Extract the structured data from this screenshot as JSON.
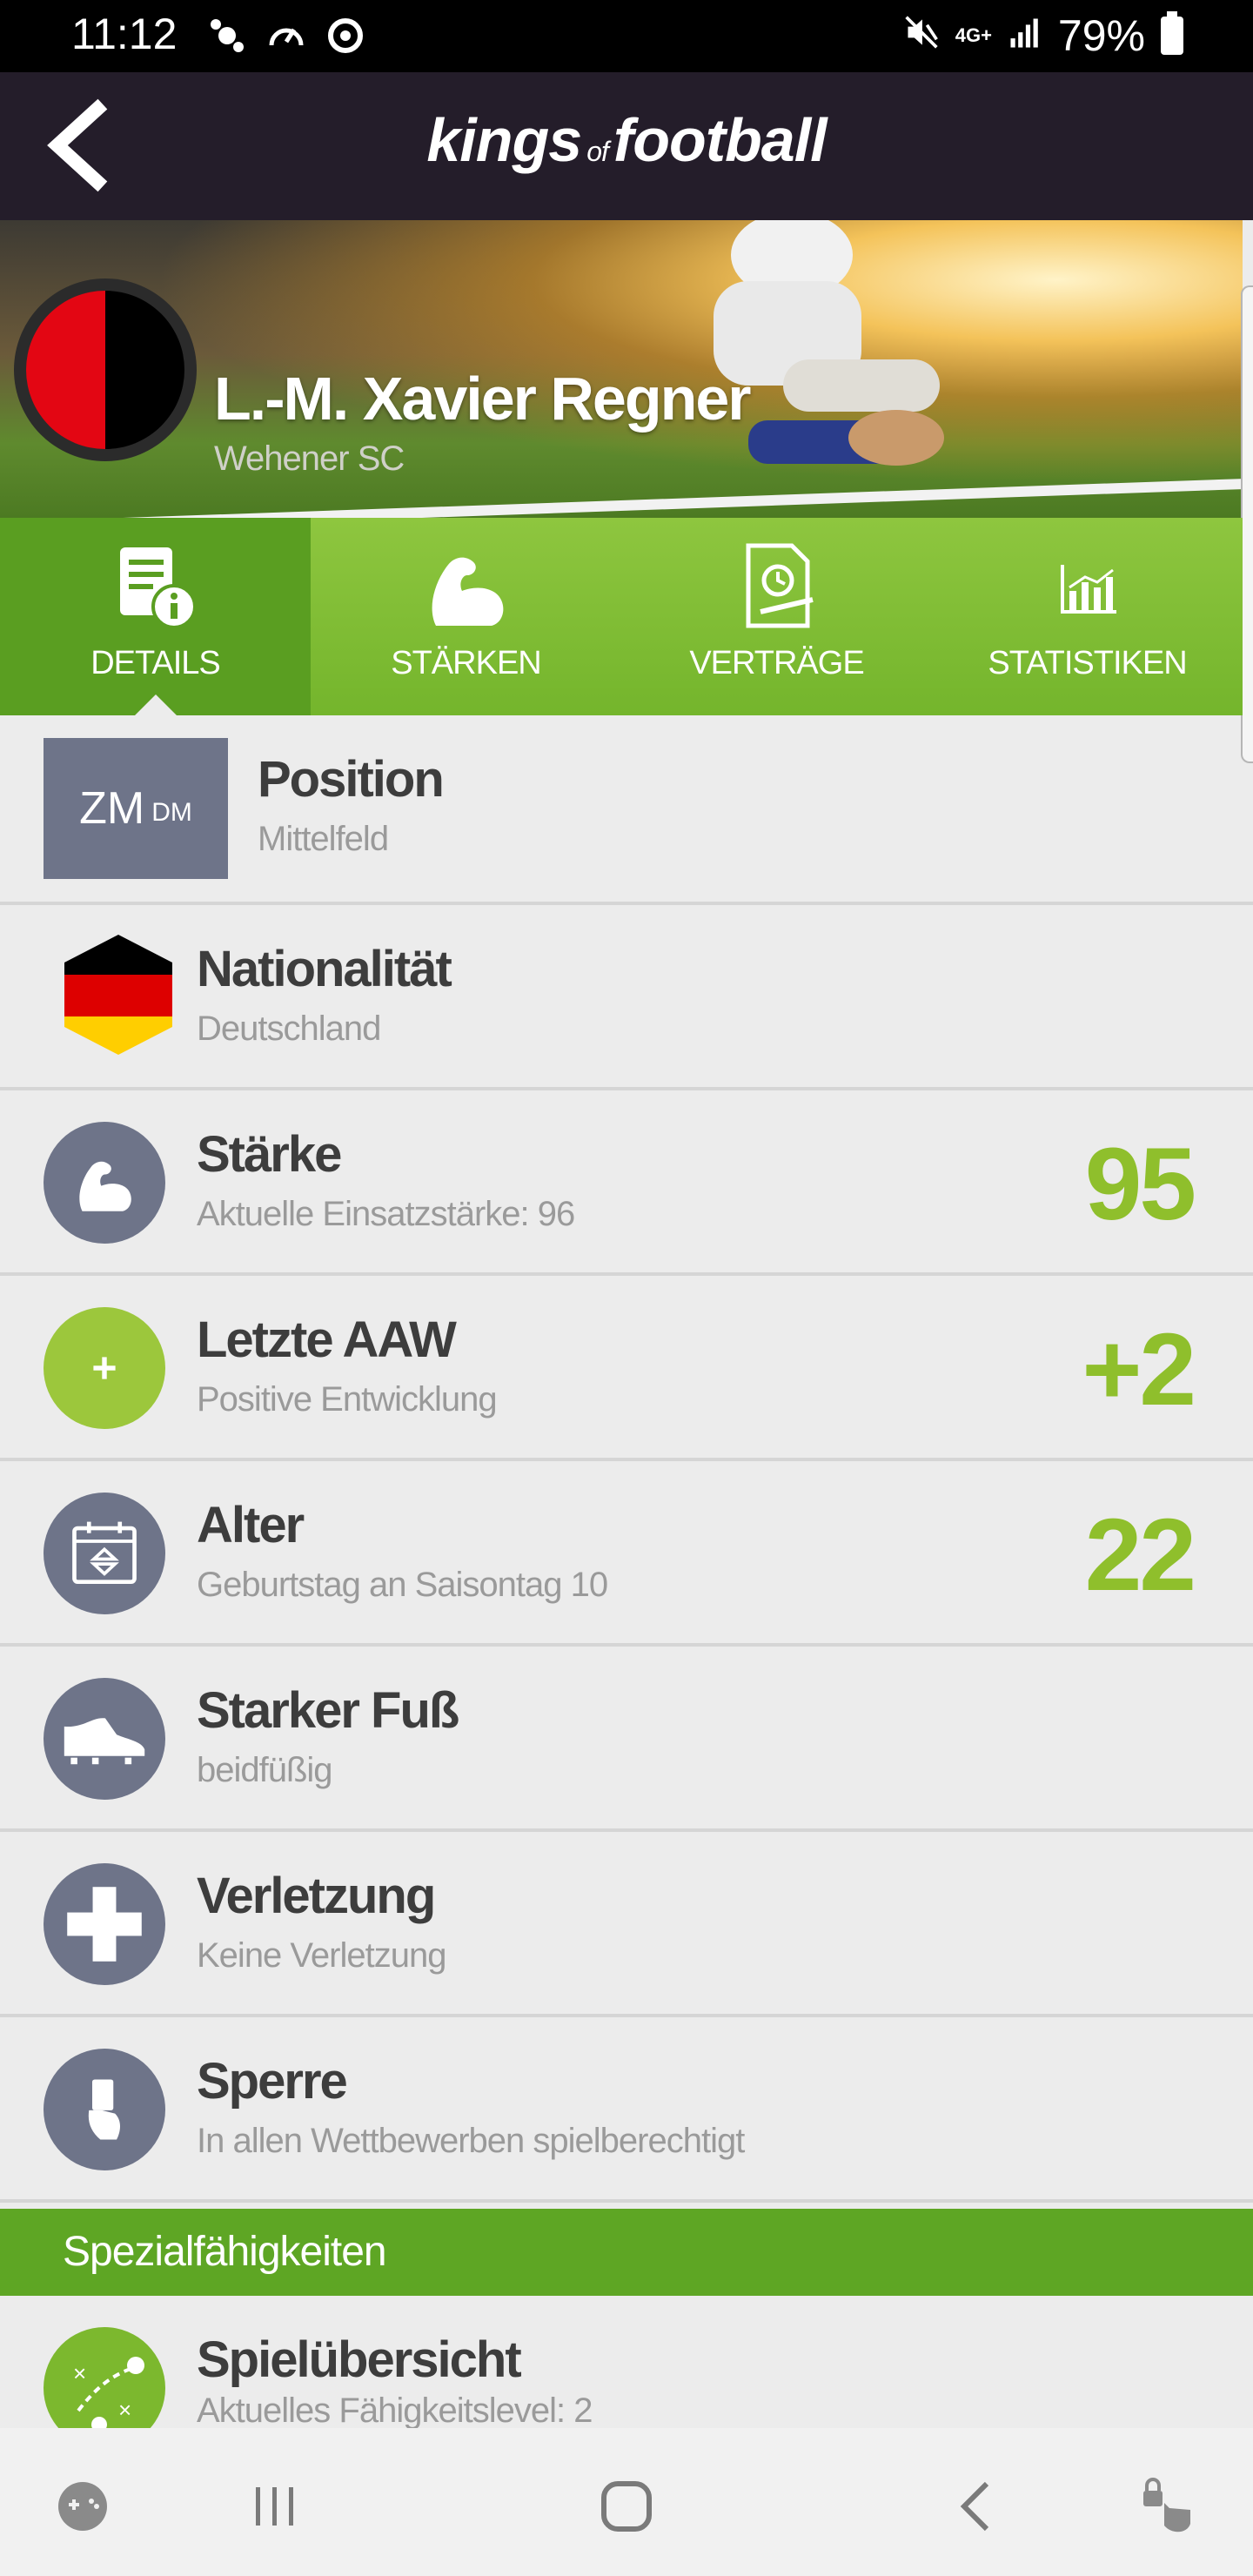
{
  "status_bar": {
    "time": "11:12",
    "network": "4G+",
    "battery": "79%"
  },
  "header": {
    "logo_prefix": "kings",
    "logo_of": "of",
    "logo_suffix": "football",
    "back_icon": "chevron-left-icon"
  },
  "profile": {
    "player_name": "L.-M. Xavier Regner",
    "club_name": "Wehener SC",
    "club_colors": [
      "#e30613",
      "#000000"
    ]
  },
  "tabs": [
    {
      "label": "DETAILS",
      "icon": "details-document-icon",
      "active": true
    },
    {
      "label": "STÄRKEN",
      "icon": "flexed-arm-icon",
      "active": false
    },
    {
      "label": "VERTRÄGE",
      "icon": "contract-icon",
      "active": false
    },
    {
      "label": "STATISTIKEN",
      "icon": "bar-chart-icon",
      "active": false
    }
  ],
  "details": {
    "position": {
      "badge_main": "ZM",
      "badge_small": "DM",
      "title": "Position",
      "subtitle": "Mittelfeld"
    },
    "nationality": {
      "title": "Nationalität",
      "subtitle": "Deutschland",
      "flag_colors": [
        "#000000",
        "#dd0000",
        "#ffce00"
      ]
    },
    "strength": {
      "title": "Stärke",
      "subtitle": "Aktuelle Einsatzstärke: 96",
      "value": "95"
    },
    "last_aaw": {
      "title": "Letzte AAW",
      "subtitle": "Positive Entwicklung",
      "value": "+2"
    },
    "age": {
      "title": "Alter",
      "subtitle": "Geburtstag an Saisontag 10",
      "value": "22"
    },
    "strong_foot": {
      "title": "Starker Fuß",
      "subtitle": "beidfüßig"
    },
    "injury": {
      "title": "Verletzung",
      "subtitle": "Keine Verletzung"
    },
    "suspension": {
      "title": "Sperre",
      "subtitle": "In allen Wettbewerben spielberechtigt"
    }
  },
  "special_abilities": {
    "heading": "Spezialfähigkeiten",
    "items": [
      {
        "title": "Spielübersicht",
        "subtitle": "Aktuelles Fähigkeitslevel: 2",
        "icon": "tactics-board-icon"
      }
    ]
  },
  "colors": {
    "accent_green": "#8fbf2c",
    "header_dark": "#241d2a",
    "icon_slate": "#6e7489"
  }
}
